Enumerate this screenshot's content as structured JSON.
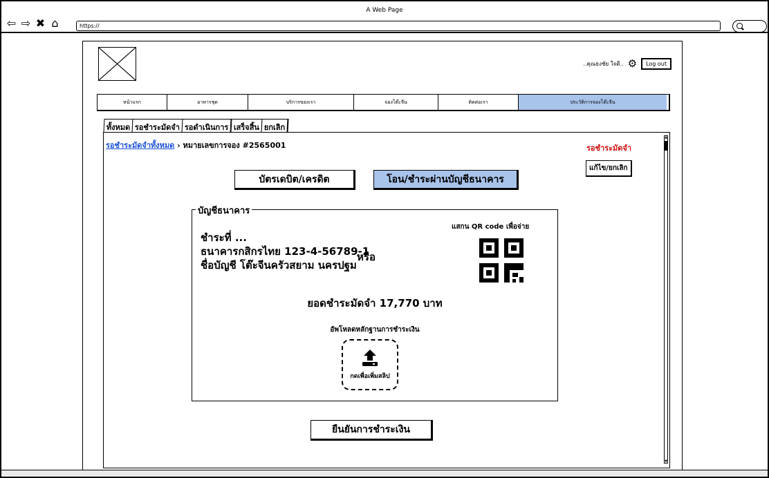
{
  "window": {
    "title": "A Web Page",
    "url": "https://"
  },
  "header": {
    "user_name": "..คุณธงชัย ใจดี..",
    "logout_label": "Log out"
  },
  "menu": {
    "items": [
      {
        "label": "หน้าแรก"
      },
      {
        "label": "อาหารชุด"
      },
      {
        "label": "บริการของเรา"
      },
      {
        "label": "จองโต๊ะจีน"
      },
      {
        "label": "ติดต่อเรา"
      },
      {
        "label": "ประวัติการจองโต๊ะจีน",
        "active": true
      }
    ]
  },
  "tabs": [
    {
      "label": "ทั้งหมด"
    },
    {
      "label": "รอชำระมัดจำ"
    },
    {
      "label": "รอดำเนินการ"
    },
    {
      "label": "เสร็จสิ้น"
    },
    {
      "label": "ยกเลิก"
    }
  ],
  "breadcrumb": {
    "link": "รอชำระมัดจำทั้งหมด",
    "separator": " › ",
    "current": "หมายเลขการจอง #2565001"
  },
  "status": {
    "label": "รอชำระมัดจำ",
    "color": "#d01010"
  },
  "edit_button": "แก้ไข/ยกเลิก",
  "payment_methods": {
    "card": "บัตรเดบิต/เครดิต",
    "bank": "โอน/ชำระผ่านบัญชีธนาคาร",
    "selected": "bank"
  },
  "bank": {
    "legend": "บัญชีธนาคาร",
    "pay_to": "ชำระที่ ...",
    "bank_line": "ธนาคารกสิกรไทย 123-4-56789-1",
    "account_name": "ชื่อบัญชี โต๊ะจีนครัวสยาม นครปฐม",
    "or": "หรือ",
    "qr_label": "แสกน QR code เพื่อจ่าย",
    "amount": "ยอดชำระมัดจำ 17,770 บาท",
    "upload_label": "อัพโหลดหลักฐานการชำระเงิน",
    "upload_text": "กดเพื่อเพิ่มสลิป"
  },
  "confirm_button": "ยืนยันการชำระเงิน",
  "colors": {
    "accent": "#a9c4eb",
    "status_red": "#d01010",
    "link": "#1a50d8"
  },
  "icons": [
    "back-arrow-icon",
    "forward-arrow-icon",
    "close-icon",
    "home-icon",
    "search-icon",
    "gear-icon",
    "qr-code-icon",
    "upload-icon"
  ]
}
